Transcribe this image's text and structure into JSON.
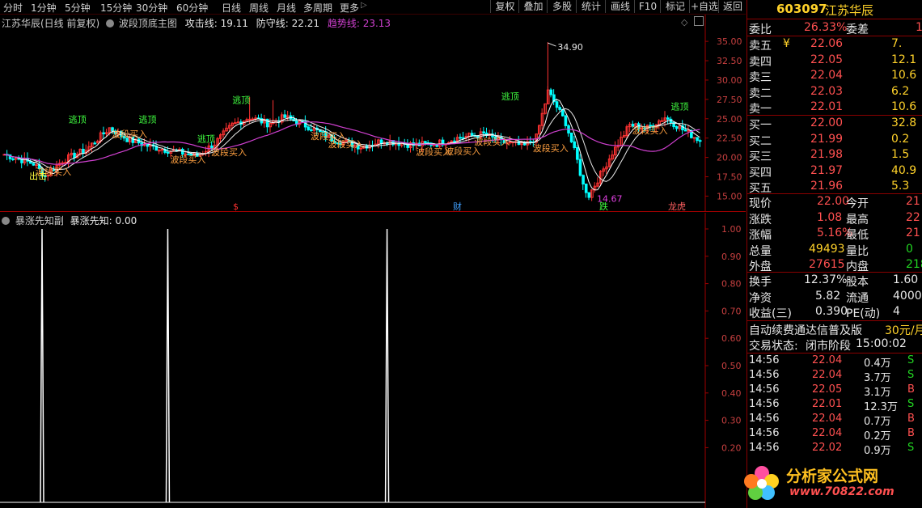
{
  "toolbar": {
    "periods": [
      "分时",
      "1分钟",
      "5分钟",
      "15分钟",
      "30分钟",
      "60分钟",
      "日线",
      "周线",
      "月线",
      "多周期",
      "更多"
    ],
    "more_arrow": "▷",
    "buttons": [
      "复权",
      "叠加",
      "多股",
      "统计",
      "画线",
      "F10",
      "标记",
      "+自选",
      "返回"
    ]
  },
  "main_chart": {
    "stock_title": "江苏华辰(日线 前复权)",
    "indicator_name": "波段顶底主图",
    "attack_label": "攻击线:",
    "attack_value": "19.11",
    "defense_label": "防守线:",
    "defense_value": "22.21",
    "trend_label": "趋势线:",
    "trend_value": "23.13",
    "y_ticks": [
      "35.00",
      "32.50",
      "30.00",
      "27.50",
      "25.00",
      "22.50",
      "20.00",
      "17.50",
      "15.00"
    ],
    "ylim": [
      14.0,
      37.0
    ],
    "high_marker": "34.90",
    "low_marker": "14.67",
    "signals_buy": [
      "波段买入",
      "波段买入",
      "波段买入",
      "波段买入",
      "波段买入",
      "波段买入",
      "波段买入",
      "波段买入",
      "波段买入",
      "波段买入",
      "波段买入"
    ],
    "signals_top": [
      "逃顶",
      "逃顶",
      "逃顶",
      "逃顶",
      "逃顶",
      "逃顶"
    ],
    "extra_label": "出击",
    "bottom_markers": [
      "$",
      "财",
      "跌",
      "龙虎"
    ],
    "colors": {
      "up": "#ff3232",
      "down": "#00ffff",
      "attack": "#ffffff",
      "trend": "#d040d0",
      "buy": "#ffa040",
      "top": "#40ff40"
    }
  },
  "sub_chart": {
    "title": "暴涨先知副",
    "value_label": "暴涨先知:",
    "value": "0.00",
    "y_ticks": [
      "1.00",
      "0.90",
      "0.80",
      "0.70",
      "0.60",
      "0.50",
      "0.40",
      "0.30",
      "0.20"
    ],
    "ylim": [
      0,
      1.0
    ],
    "spikes_at_bar": [
      13,
      56,
      131
    ]
  },
  "quote": {
    "code": "603097",
    "name": "江苏华辰",
    "weibi_label": "委比",
    "weibi": "26.33%",
    "weicha_label": "委差",
    "weicha": "1",
    "asks": [
      {
        "label": "卖五",
        "price": "22.06",
        "vol": "7."
      },
      {
        "label": "卖四",
        "price": "22.05",
        "vol": "12.1"
      },
      {
        "label": "卖三",
        "price": "22.04",
        "vol": "10.6"
      },
      {
        "label": "卖二",
        "price": "22.03",
        "vol": "6.2"
      },
      {
        "label": "卖一",
        "price": "22.01",
        "vol": "10.6"
      }
    ],
    "ask_marker": "¥",
    "bids": [
      {
        "label": "买一",
        "price": "22.00",
        "vol": "32.8"
      },
      {
        "label": "买二",
        "price": "21.99",
        "vol": "0.2"
      },
      {
        "label": "买三",
        "price": "21.98",
        "vol": "1.5"
      },
      {
        "label": "买四",
        "price": "21.97",
        "vol": "40.9"
      },
      {
        "label": "买五",
        "price": "21.96",
        "vol": "5.3"
      }
    ],
    "stats": [
      {
        "l1": "现价",
        "v1": "22.00",
        "l2": "今开",
        "v2": "21"
      },
      {
        "l1": "涨跌",
        "v1": "1.08",
        "l2": "最高",
        "v2": "22"
      },
      {
        "l1": "涨幅",
        "v1": "5.16%",
        "l2": "最低",
        "v2": "21"
      },
      {
        "l1": "总量",
        "v1": "49493",
        "l2": "量比",
        "v2": "0"
      },
      {
        "l1": "外盘",
        "v1": "27615",
        "l2": "内盘",
        "v2": "218"
      }
    ],
    "stats2": [
      {
        "l1": "换手",
        "v1": "12.37%",
        "l2": "股本",
        "v2": "1.60"
      },
      {
        "l1": "净资",
        "v1": "5.82",
        "l2": "流通",
        "v2": "4000"
      },
      {
        "l1": "收益(三)",
        "v1": "0.390",
        "l2": "PE(动)",
        "v2": "4"
      }
    ],
    "promo": "自动续费通达信普及版",
    "promo_price": "30元/月",
    "status_label": "交易状态:",
    "status": "闭市阶段",
    "status_time": "15:00:02",
    "ticks": [
      {
        "t": "14:56",
        "p": "22.04",
        "v": "0.4万",
        "s": "S"
      },
      {
        "t": "14:56",
        "p": "22.04",
        "v": "3.7万",
        "s": "S"
      },
      {
        "t": "14:56",
        "p": "22.05",
        "v": "3.1万",
        "s": "B"
      },
      {
        "t": "14:56",
        "p": "22.01",
        "v": "12.3万",
        "s": "S"
      },
      {
        "t": "14:56",
        "p": "22.04",
        "v": "0.7万",
        "s": "B"
      },
      {
        "t": "14:56",
        "p": "22.04",
        "v": "0.2万",
        "s": "B"
      },
      {
        "t": "14:56",
        "p": "22.02",
        "v": "0.9万",
        "s": "S"
      }
    ],
    "watermark": "分析家公式网",
    "watermark_url": "www.70822.com"
  }
}
